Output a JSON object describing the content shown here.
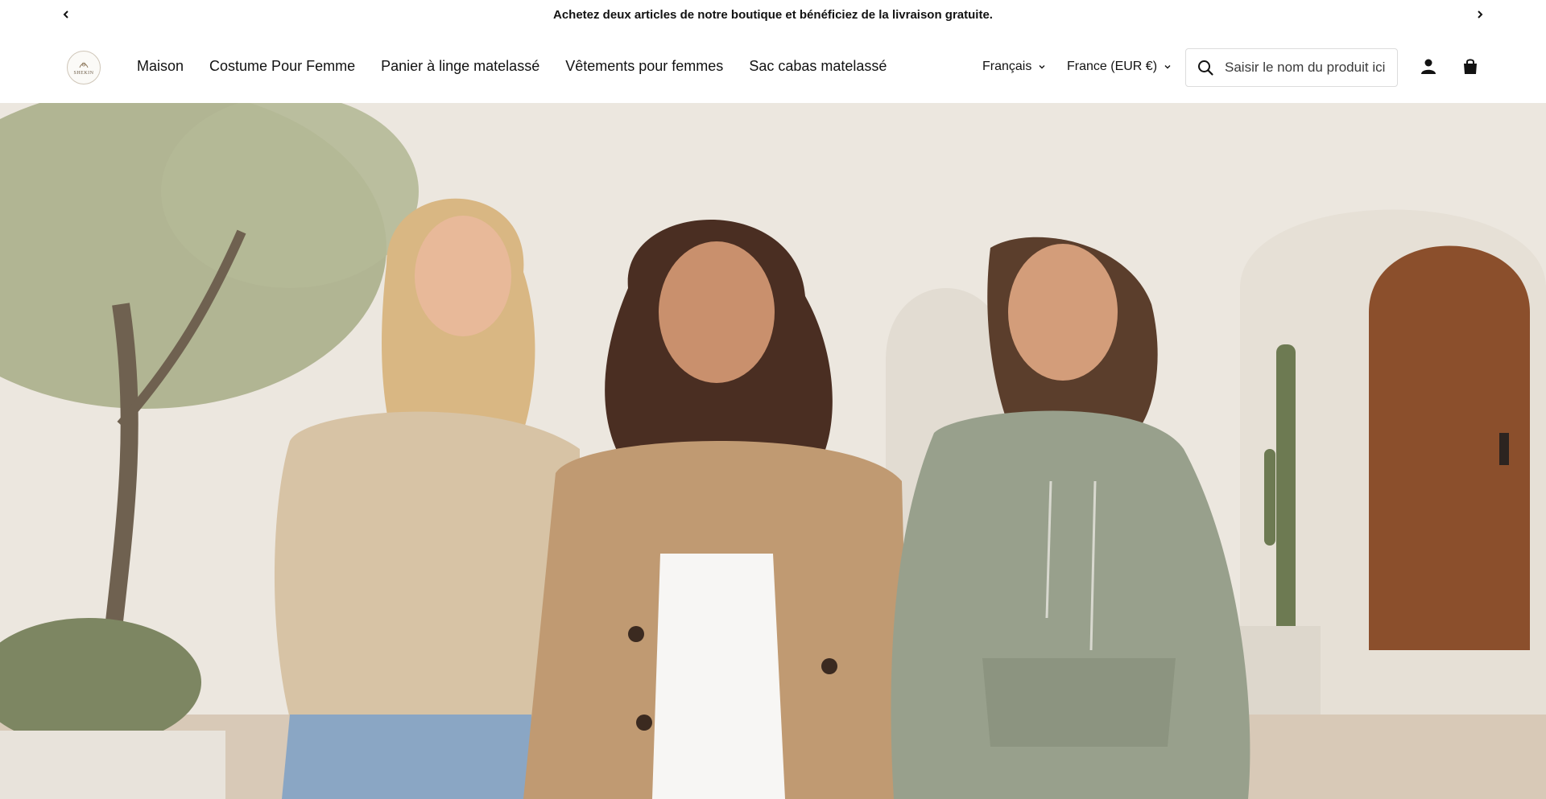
{
  "announcement": {
    "text": "Achetez deux articles de notre boutique et bénéficiez de la livraison gratuite.",
    "prev_icon": "chevron-left-icon",
    "next_icon": "chevron-right-icon"
  },
  "header": {
    "logo_text": "SHEKIN",
    "nav": [
      {
        "label": "Maison"
      },
      {
        "label": "Costume Pour Femme"
      },
      {
        "label": "Panier à linge matelassé"
      },
      {
        "label": "Vêtements pour femmes"
      },
      {
        "label": "Sac cabas matelassé"
      }
    ],
    "language": "Français",
    "country": "France (EUR €)",
    "search": {
      "placeholder": "Saisir le nom du produit ici e",
      "icon": "search-icon"
    },
    "account_icon": "account-icon",
    "cart_icon": "shopping-bag-icon"
  },
  "colors": {
    "text": "#121212",
    "background": "#ffffff",
    "hero_wall": "#efebe4"
  }
}
